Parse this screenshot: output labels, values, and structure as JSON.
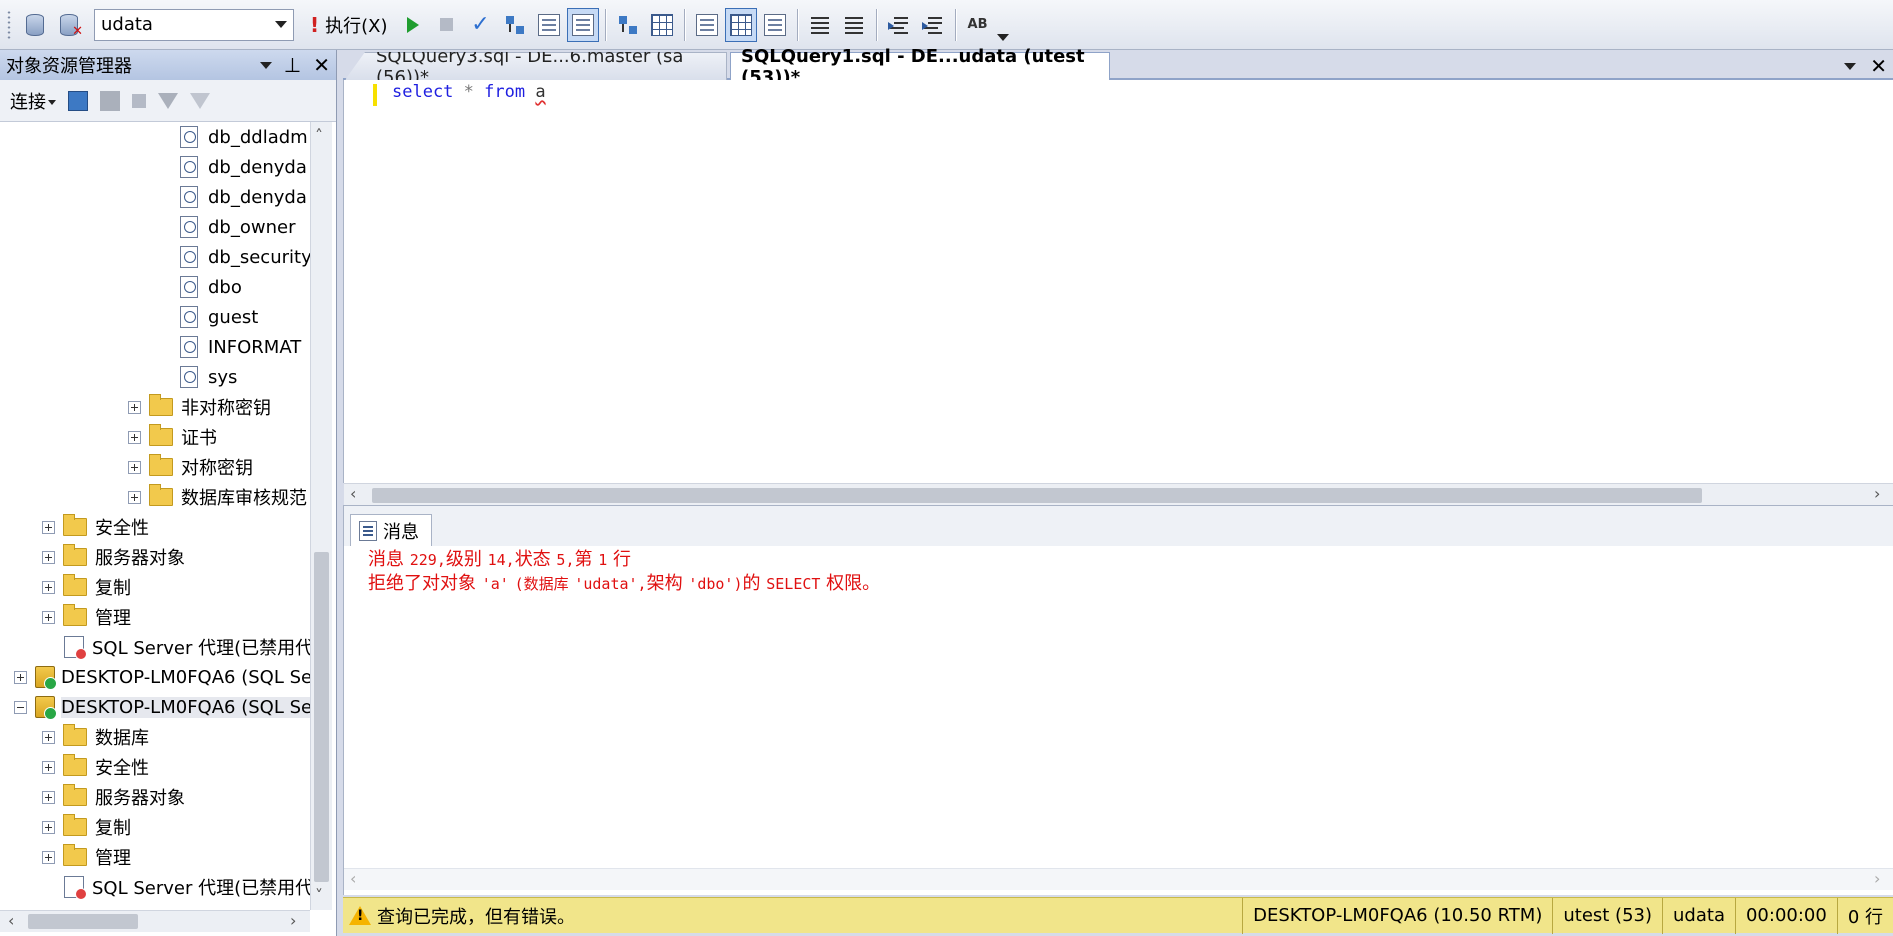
{
  "toolbar": {
    "database": "udata",
    "execute_label": "执行(X)"
  },
  "object_explorer": {
    "title": "对象资源管理器",
    "connect_label": "连接",
    "tree": [
      {
        "label": "db_ddladm",
        "kind": "schema"
      },
      {
        "label": "db_denyda",
        "kind": "schema"
      },
      {
        "label": "db_denyda",
        "kind": "schema"
      },
      {
        "label": "db_owner",
        "kind": "schema"
      },
      {
        "label": "db_security",
        "kind": "schema"
      },
      {
        "label": "dbo",
        "kind": "schema"
      },
      {
        "label": "guest",
        "kind": "schema"
      },
      {
        "label": "INFORMAT",
        "kind": "schema"
      },
      {
        "label": "sys",
        "kind": "schema"
      },
      {
        "label": "非对称密钥",
        "kind": "folder"
      },
      {
        "label": "证书",
        "kind": "folder"
      },
      {
        "label": "对称密钥",
        "kind": "folder"
      },
      {
        "label": "数据库审核规范",
        "kind": "folder"
      },
      {
        "label": "安全性",
        "kind": "folder"
      },
      {
        "label": "服务器对象",
        "kind": "folder"
      },
      {
        "label": "复制",
        "kind": "folder"
      },
      {
        "label": "管理",
        "kind": "folder"
      },
      {
        "label": "SQL Server 代理(已禁用代",
        "kind": "agent"
      },
      {
        "label": "DESKTOP-LM0FQA6 (SQL Se",
        "kind": "server"
      },
      {
        "label": "DESKTOP-LM0FQA6 (SQL Se",
        "kind": "server"
      },
      {
        "label": "数据库",
        "kind": "folder"
      },
      {
        "label": "安全性",
        "kind": "folder"
      },
      {
        "label": "服务器对象",
        "kind": "folder"
      },
      {
        "label": "复制",
        "kind": "folder"
      },
      {
        "label": "管理",
        "kind": "folder"
      },
      {
        "label": "SQL Server 代理(已禁用代",
        "kind": "agent"
      }
    ]
  },
  "tabs": [
    {
      "label": "SQLQuery3.sql - DE...6.master (sa (56))*",
      "active": false
    },
    {
      "label": "SQLQuery1.sql - DE...udata (utest (53))*",
      "active": true
    }
  ],
  "editor": {
    "kw_select": "select",
    "star": "*",
    "kw_from": "from",
    "table": "a"
  },
  "results": {
    "tab_label": "消息",
    "line1_a": "消息",
    "line1_b": "229,",
    "line1_c": "级别",
    "line1_d": "14,",
    "line1_e": "状态",
    "line1_f": "5,",
    "line1_g": "第",
    "line1_h": "1",
    "line1_i": "行",
    "line2_a": "拒绝了对对象",
    "line2_b": "'a'",
    "line2_c": "(数据库",
    "line2_d": "'udata',",
    "line2_e": "架构",
    "line2_f": "'dbo')",
    "line2_g": "的",
    "line2_h": "SELECT",
    "line2_i": "权限。"
  },
  "status": {
    "message": "查询已完成，但有错误。",
    "server": "DESKTOP-LM0FQA6 (10.50 RTM)",
    "user": "utest (53)",
    "database": "udata",
    "elapsed": "00:00:00",
    "rows": "0 行"
  },
  "colors": {
    "error_text": "#e01010",
    "status_bar": "#f1e58a",
    "keyword": "#1f1fe0"
  }
}
